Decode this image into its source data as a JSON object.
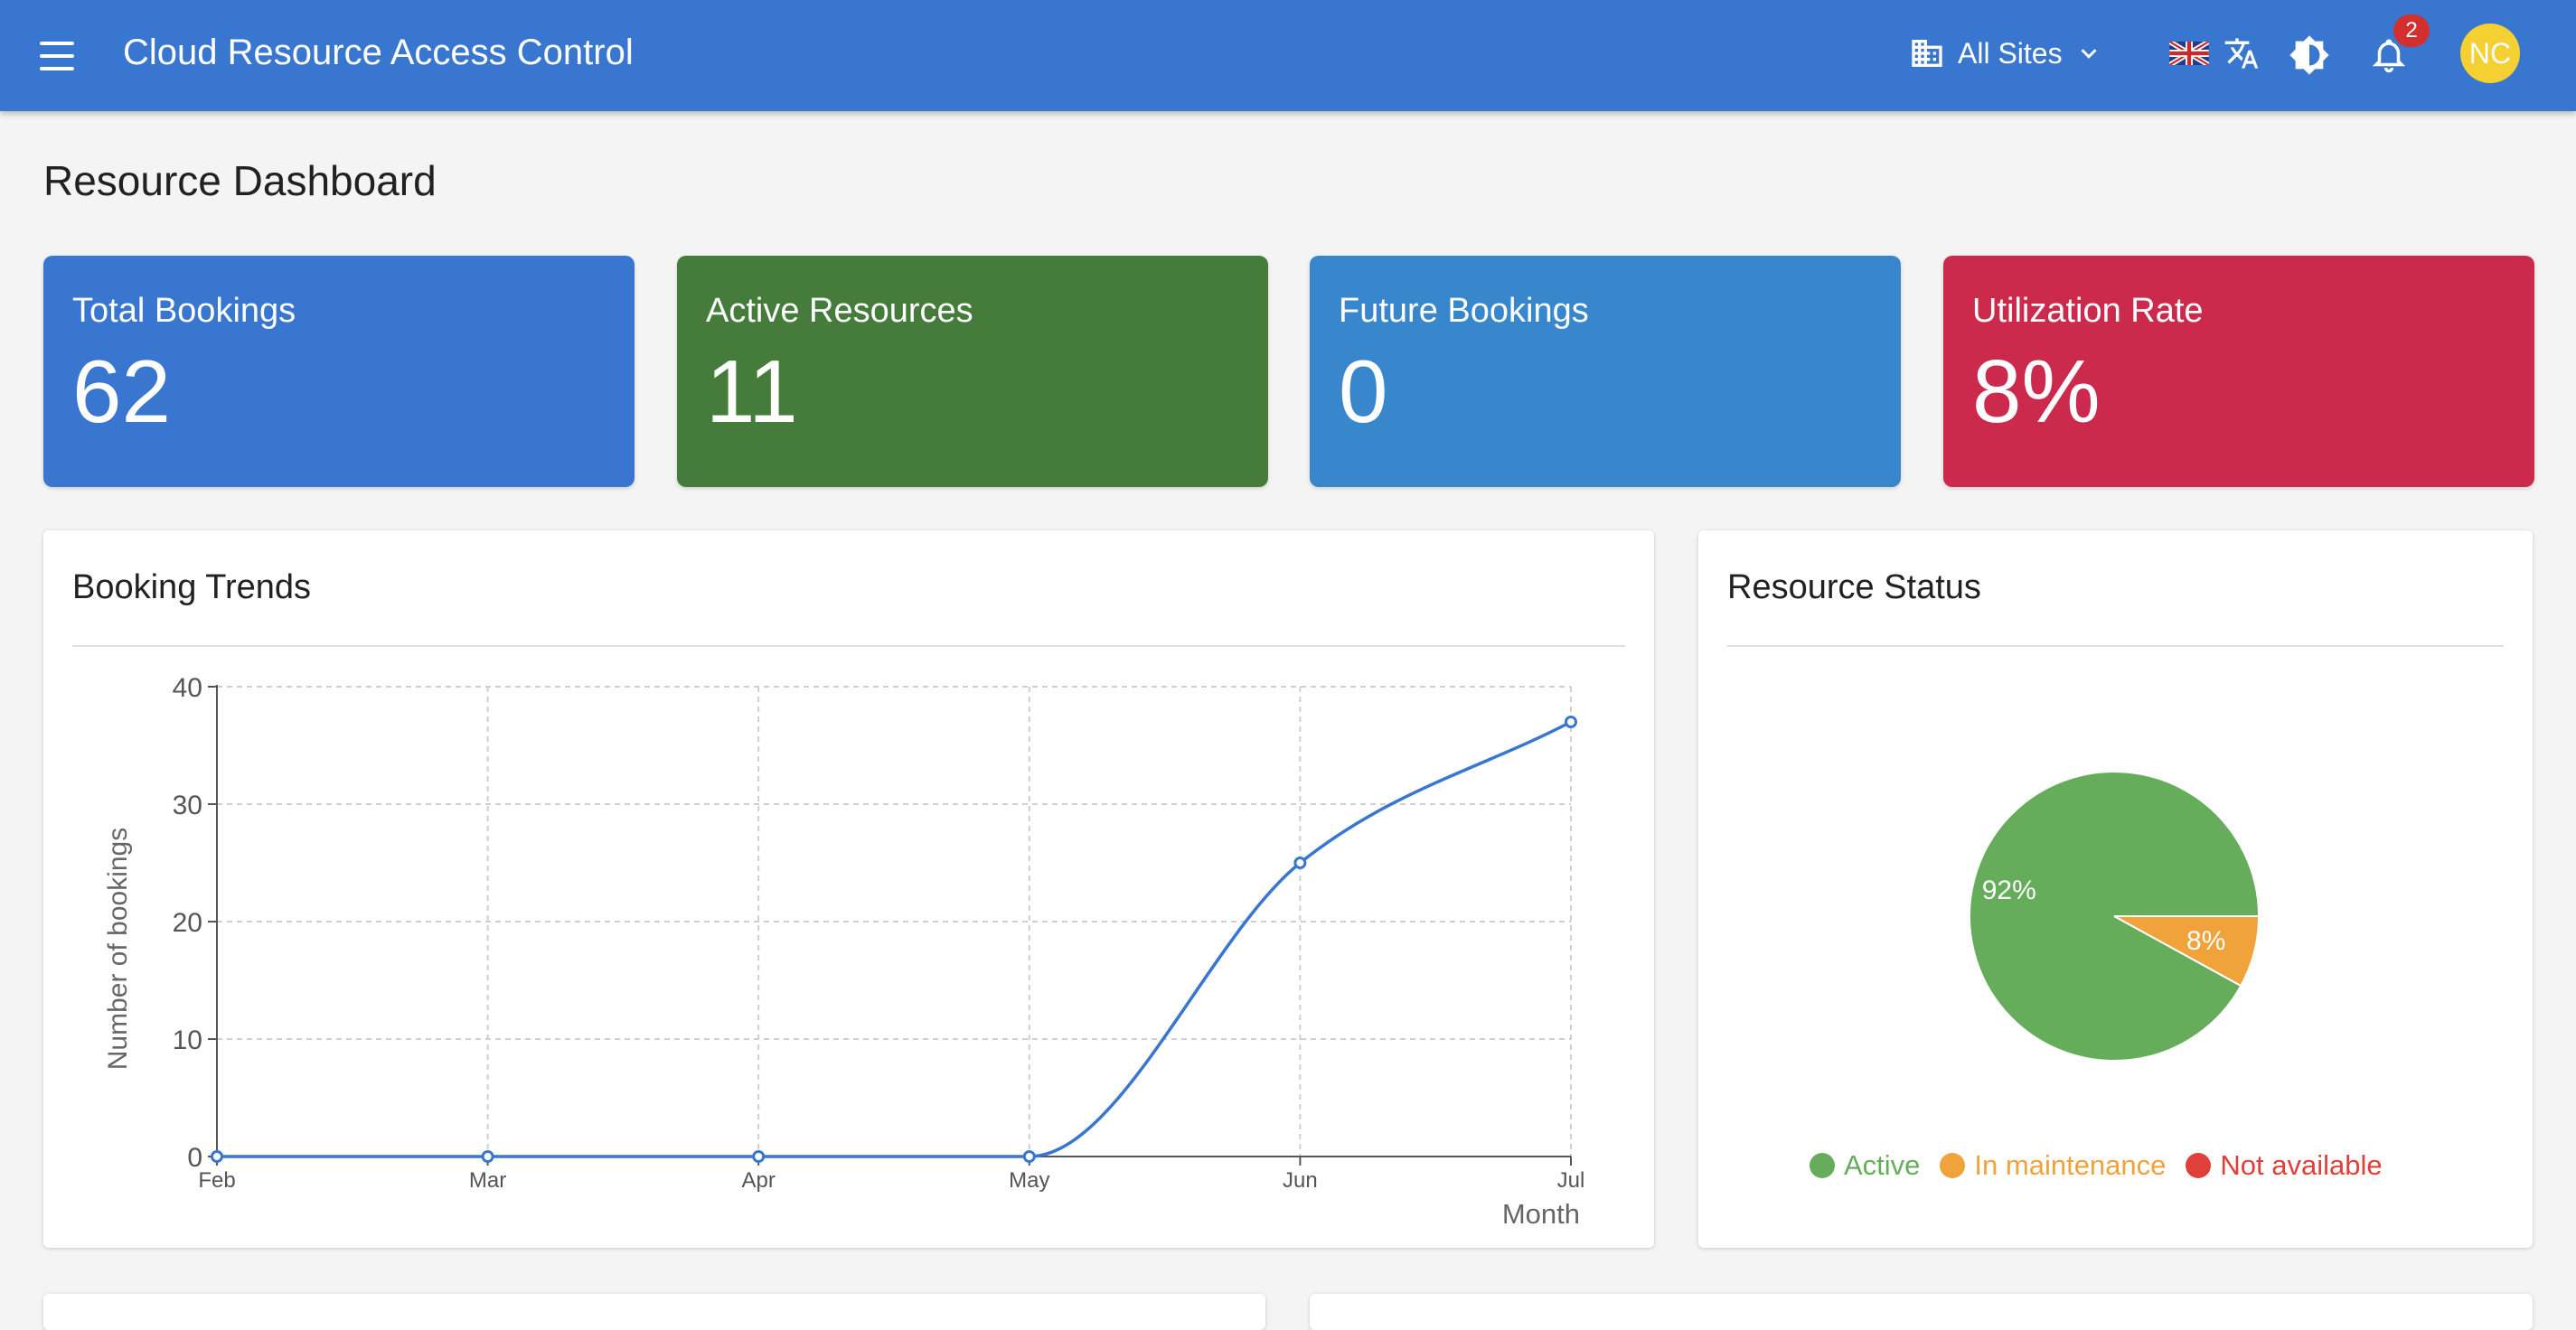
{
  "app": {
    "title": "Cloud Resource Access Control",
    "site_selector": "All Sites",
    "notification_count": "2",
    "avatar_initials": "NC"
  },
  "page": {
    "title": "Resource Dashboard"
  },
  "stats": [
    {
      "label": "Total Bookings",
      "value": "62",
      "color": "#3876cf"
    },
    {
      "label": "Active Resources",
      "value": "11",
      "color": "#457c3c"
    },
    {
      "label": "Future Bookings",
      "value": "0",
      "color": "#3886cc"
    },
    {
      "label": "Utilization Rate",
      "value": "8%",
      "color": "#cc2a4c"
    }
  ],
  "booking_trends": {
    "title": "Booking Trends"
  },
  "resource_status": {
    "title": "Resource Status"
  },
  "colors": {
    "active": "#66ad5b",
    "maintenance": "#f0a23b",
    "unavailable": "#e0403a",
    "line": "#3876cf"
  },
  "chart_data": [
    {
      "type": "line",
      "title": "Booking Trends",
      "xlabel": "Month",
      "ylabel": "Number of bookings",
      "categories": [
        "Feb",
        "Mar",
        "Apr",
        "May",
        "Jun",
        "Jul"
      ],
      "series": [
        {
          "values": [
            0,
            0,
            0,
            0,
            25,
            37
          ]
        }
      ],
      "ylim": [
        0,
        40
      ],
      "yticks": [
        0,
        10,
        20,
        30,
        40
      ],
      "grid": true
    },
    {
      "type": "pie",
      "title": "Resource Status",
      "labels": [
        "Active",
        "In maintenance",
        "Not available"
      ],
      "values": [
        92,
        8,
        0
      ],
      "slice_labels": [
        "92%",
        "8%",
        ""
      ],
      "legend": "bottom"
    }
  ]
}
